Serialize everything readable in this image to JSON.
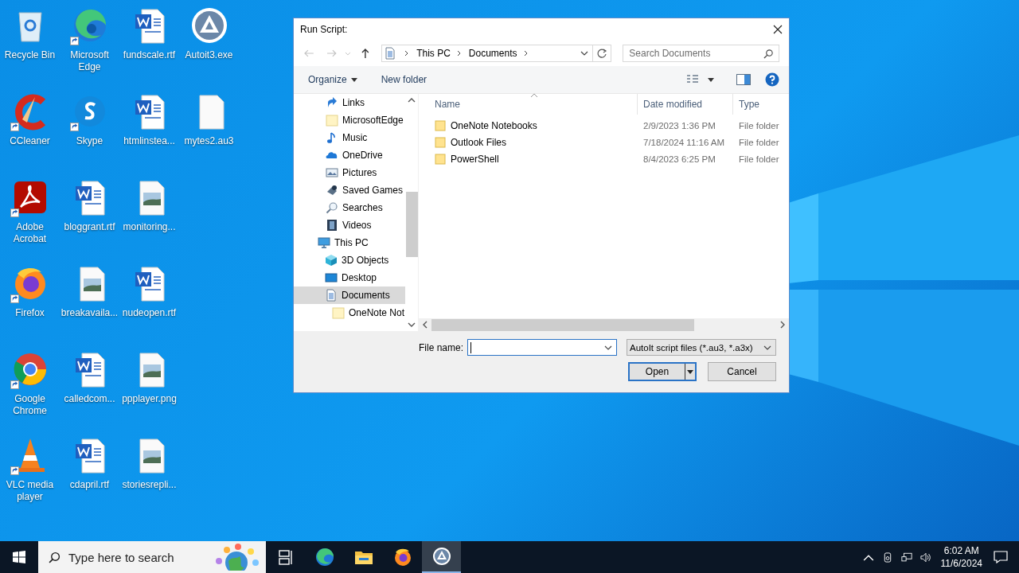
{
  "desktop": {
    "rows": [
      [
        {
          "label": "Recycle Bin",
          "kind": "recycle",
          "shortcut": false
        },
        {
          "label": "Microsoft Edge",
          "kind": "edge",
          "shortcut": true
        },
        {
          "label": "fundscale.rtf",
          "kind": "word",
          "shortcut": false
        },
        {
          "label": "Autoit3.exe",
          "kind": "autoit",
          "shortcut": false
        }
      ],
      [
        {
          "label": "CCleaner",
          "kind": "ccleaner",
          "shortcut": true
        },
        {
          "label": "Skype",
          "kind": "skype",
          "shortcut": true
        },
        {
          "label": "htmlinstea...",
          "kind": "word",
          "shortcut": false
        },
        {
          "label": "mytes2.au3",
          "kind": "blank",
          "shortcut": false
        }
      ],
      [
        {
          "label": "Adobe Acrobat",
          "kind": "acrobat",
          "shortcut": true
        },
        {
          "label": "bloggrant.rtf",
          "kind": "word",
          "shortcut": false
        },
        {
          "label": "monitoring...",
          "kind": "image",
          "shortcut": false
        }
      ],
      [
        {
          "label": "Firefox",
          "kind": "firefox",
          "shortcut": true
        },
        {
          "label": "breakavaila...",
          "kind": "image",
          "shortcut": false
        },
        {
          "label": "nudeopen.rtf",
          "kind": "word",
          "shortcut": false
        }
      ],
      [
        {
          "label": "Google Chrome",
          "kind": "chrome",
          "shortcut": true
        },
        {
          "label": "calledcom...",
          "kind": "word",
          "shortcut": false
        },
        {
          "label": "ppplayer.png",
          "kind": "image",
          "shortcut": false
        }
      ],
      [
        {
          "label": "VLC media player",
          "kind": "vlc",
          "shortcut": true
        },
        {
          "label": "cdapril.rtf",
          "kind": "word",
          "shortcut": false
        },
        {
          "label": "storiesrepli...",
          "kind": "image",
          "shortcut": false
        }
      ]
    ]
  },
  "dialog": {
    "title": "Run Script:",
    "breadcrumb": [
      "This PC",
      "Documents"
    ],
    "search": {
      "placeholder": "Search Documents"
    },
    "toolbar": {
      "organize": "Organize",
      "new_folder": "New folder"
    },
    "tree": {
      "folders": [
        {
          "label": "Links",
          "kind": "links",
          "selected": false
        },
        {
          "label": "MicrosoftEdge",
          "kind": "folder",
          "selected": false
        },
        {
          "label": "Music",
          "kind": "music",
          "selected": false
        },
        {
          "label": "OneDrive",
          "kind": "cloud",
          "selected": false
        },
        {
          "label": "Pictures",
          "kind": "pictures",
          "selected": false
        },
        {
          "label": "Saved Games",
          "kind": "games",
          "selected": false
        },
        {
          "label": "Searches",
          "kind": "search",
          "selected": false
        },
        {
          "label": "Videos",
          "kind": "videos",
          "selected": false
        }
      ],
      "nodes": [
        {
          "label": "This PC",
          "kind": "pc",
          "selected": false,
          "children": [
            {
              "label": "3D Objects",
              "kind": "cube",
              "selected": false
            },
            {
              "label": "Desktop",
              "kind": "desktop",
              "selected": false
            },
            {
              "label": "Documents",
              "kind": "documents",
              "selected": true,
              "children": [
                {
                  "label": "OneNote Not",
                  "kind": "folder",
                  "selected": false
                }
              ]
            }
          ]
        }
      ]
    },
    "columns": [
      "Name",
      "Date modified",
      "Type"
    ],
    "files": [
      {
        "name": "OneNote Notebooks",
        "date": "2/9/2023 1:36 PM",
        "type": "File folder"
      },
      {
        "name": "Outlook Files",
        "date": "7/18/2024 11:16 AM",
        "type": "File folder"
      },
      {
        "name": "PowerShell",
        "date": "8/4/2023 6:25 PM",
        "type": "File folder"
      }
    ],
    "file_name_label": "File name:",
    "filter": "AutoIt script files (*.au3, *.a3x)",
    "buttons": [
      {
        "label": "Open",
        "kind": "split"
      },
      {
        "label": "Cancel",
        "kind": "plain"
      }
    ]
  },
  "taskbar": {
    "search": {
      "placeholder": "Type here to search"
    },
    "apps": [
      {
        "kind": "taskview",
        "active": false
      },
      {
        "kind": "edge",
        "active": false
      },
      {
        "kind": "explorer",
        "active": false
      },
      {
        "kind": "firefox",
        "active": false
      },
      {
        "kind": "autoit",
        "active": true
      }
    ],
    "clock": {
      "time": "6:02 AM",
      "date": "11/6/2024"
    }
  }
}
